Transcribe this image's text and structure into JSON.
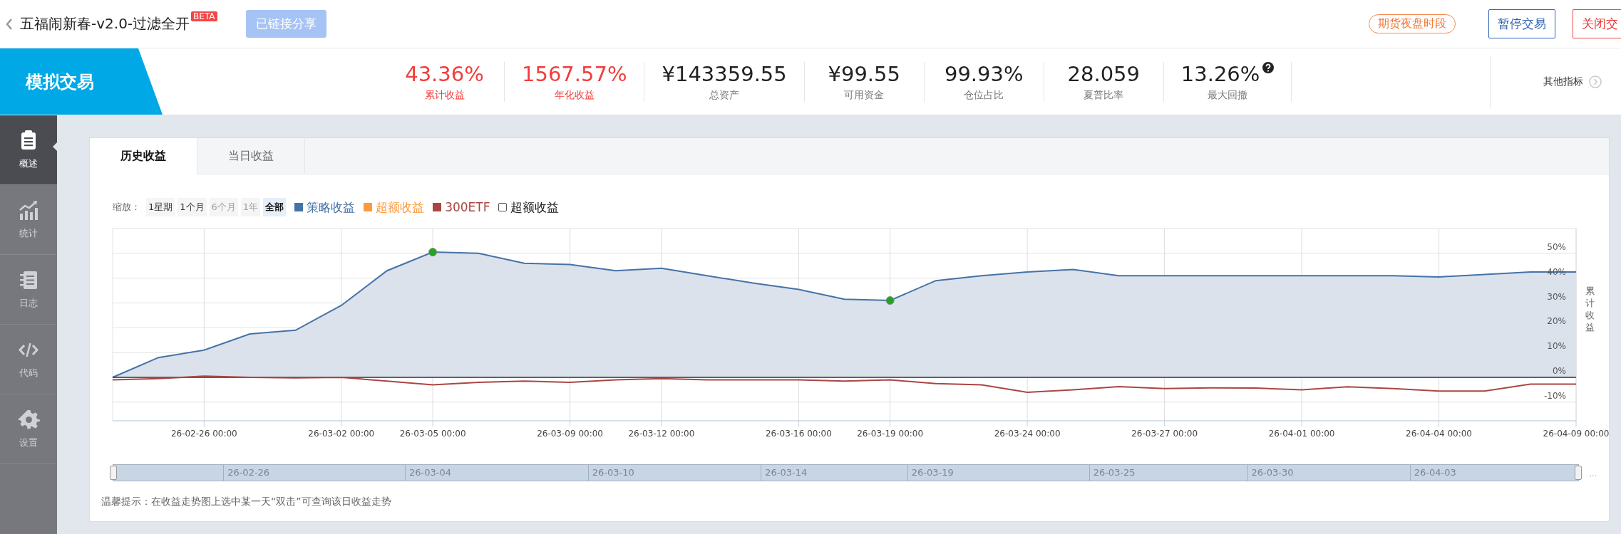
{
  "header": {
    "title": "五福闹新春-v2.0-过滤全开",
    "badge": "BETA",
    "share_button": "已链接分享",
    "session_tag": "期货夜盘时段",
    "buttons": [
      {
        "label": "暂停交易",
        "kind": "primary"
      },
      {
        "label": "关闭交",
        "kind": "danger"
      }
    ]
  },
  "summary": {
    "mode": "模拟交易",
    "stats": [
      {
        "value": "43.36%",
        "label": "累计收益",
        "color": "#f23c3c",
        "help": false
      },
      {
        "value": "1567.57%",
        "label": "年化收益",
        "color": "#f23c3c",
        "help": false
      },
      {
        "value": "¥143359.55",
        "label": "总资产",
        "color": "#222222",
        "help": false
      },
      {
        "value": "¥99.55",
        "label": "可用资金",
        "color": "#222222",
        "help": false
      },
      {
        "value": "99.93%",
        "label": "仓位占比",
        "color": "#222222",
        "help": false
      },
      {
        "value": "28.059",
        "label": "夏普比率",
        "color": "#222222",
        "help": false
      },
      {
        "value": "13.26%",
        "label": "最大回撤",
        "color": "#222222",
        "help": true
      }
    ],
    "more": "其他指标"
  },
  "sidebar": {
    "items": [
      {
        "label": "概述",
        "selected": true
      },
      {
        "label": "统计",
        "selected": false
      },
      {
        "label": "日志",
        "selected": false
      },
      {
        "label": "代码",
        "selected": false
      },
      {
        "label": "设置",
        "selected": false
      }
    ]
  },
  "chart_panel": {
    "tabs": [
      {
        "label": "历史收益",
        "selected": true
      },
      {
        "label": "当日收益",
        "selected": false
      }
    ],
    "zoom_label": "缩放：",
    "zoom_options": [
      {
        "label": "1星期",
        "selected": false,
        "disabled": false
      },
      {
        "label": "1个月",
        "selected": false,
        "disabled": false
      },
      {
        "label": "6个月",
        "selected": false,
        "disabled": true
      },
      {
        "label": "1年",
        "selected": false,
        "disabled": true
      },
      {
        "label": "全部",
        "selected": true,
        "disabled": false
      }
    ],
    "legend_extra": {
      "label": "超额收益",
      "color": "#ff9a3c"
    },
    "toggle": {
      "label": "超额收益",
      "checked": false
    },
    "chart_data": {
      "type": "line",
      "ylabel": "累计收益",
      "ylim": [
        -17.5,
        60
      ],
      "categories": [
        null,
        null,
        "26-02-26 00:00",
        null,
        null,
        "26-03-02 00:00",
        null,
        "26-03-05 00:00",
        null,
        null,
        "26-03-09 00:00",
        null,
        "26-03-12 00:00",
        null,
        null,
        "26-03-16 00:00",
        null,
        "26-03-19 00:00",
        null,
        null,
        "26-03-24 00:00",
        null,
        null,
        "26-03-27 00:00",
        null,
        null,
        "26-04-01 00:00",
        null,
        null,
        "26-04-04 00:00",
        null,
        null,
        "26-04-09 00:00"
      ],
      "yticks": [
        {
          "value": -10,
          "label": "-10%"
        },
        {
          "value": 0,
          "label": "0%"
        },
        {
          "value": 10,
          "label": "10%"
        },
        {
          "value": 20,
          "label": "20%"
        },
        {
          "value": 30,
          "label": "30%"
        },
        {
          "value": 40,
          "label": "40%"
        },
        {
          "value": 50,
          "label": "50%"
        }
      ],
      "series": [
        {
          "name": "策略收益",
          "color": "#4572a7",
          "values": [
            0,
            8,
            11,
            17.5,
            19,
            29,
            43,
            50.5,
            50,
            46,
            45.5,
            43,
            44,
            41,
            38,
            35.5,
            31.5,
            31,
            39,
            41,
            42.5,
            43.5,
            41,
            41,
            41,
            41,
            41,
            41,
            41,
            40.5,
            41.5,
            42.5,
            42.5
          ]
        },
        {
          "name": "300ETF",
          "color": "#aa4643",
          "values": [
            -1,
            -0.5,
            0.5,
            0,
            -0.2,
            0,
            -1.5,
            -3,
            -2,
            -1.5,
            -2,
            -1,
            -0.5,
            -1,
            -1,
            -1,
            -1.5,
            -1,
            -2.5,
            -3,
            -6,
            -5,
            -3.7,
            -4.5,
            -4.2,
            -4.3,
            -5,
            -3.8,
            -4.5,
            -5.5,
            -5.5,
            -2.7,
            -2.7
          ]
        }
      ],
      "grid": true
    },
    "navigator": {
      "labels": [
        "26-02-26",
        "26-03-04",
        "26-03-10",
        "26-03-14",
        "26-03-19",
        "26-03-25",
        "26-03-30",
        "26-04-03"
      ],
      "more": "..."
    },
    "tip": "温馨提示：在收益走势图上选中某一天“双击”可查询该日收益走势"
  }
}
